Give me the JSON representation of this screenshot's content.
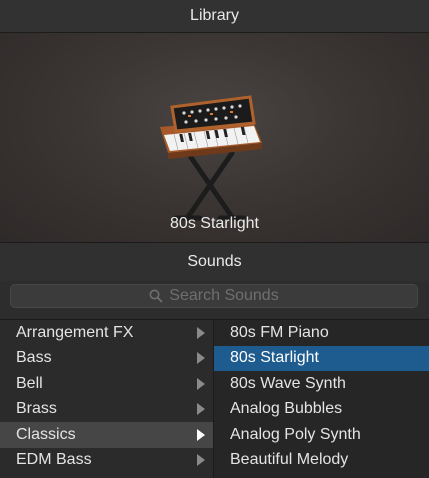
{
  "header": {
    "title": "Library"
  },
  "preview": {
    "instrument_name": "80s Starlight",
    "image": "vintage-modular-synth-on-x-stand"
  },
  "sounds_section": {
    "title": "Sounds",
    "search_placeholder": "Search Sounds",
    "search_icon": "search-icon"
  },
  "categories": [
    {
      "label": "Arrangement FX",
      "selected": false
    },
    {
      "label": "Bass",
      "selected": false
    },
    {
      "label": "Bell",
      "selected": false
    },
    {
      "label": "Brass",
      "selected": false
    },
    {
      "label": "Classics",
      "selected": true
    },
    {
      "label": "EDM Bass",
      "selected": false
    }
  ],
  "patches": [
    {
      "label": "80s FM Piano",
      "selected": false
    },
    {
      "label": "80s Starlight",
      "selected": true
    },
    {
      "label": "80s Wave Synth",
      "selected": false
    },
    {
      "label": "Analog Bubbles",
      "selected": false
    },
    {
      "label": "Analog Poly Synth",
      "selected": false
    },
    {
      "label": "Beautiful Melody",
      "selected": false
    }
  ],
  "colors": {
    "selection_blue": "#1e5b8f",
    "category_selected": "#464646",
    "panel_bg": "#2a2a2a"
  }
}
